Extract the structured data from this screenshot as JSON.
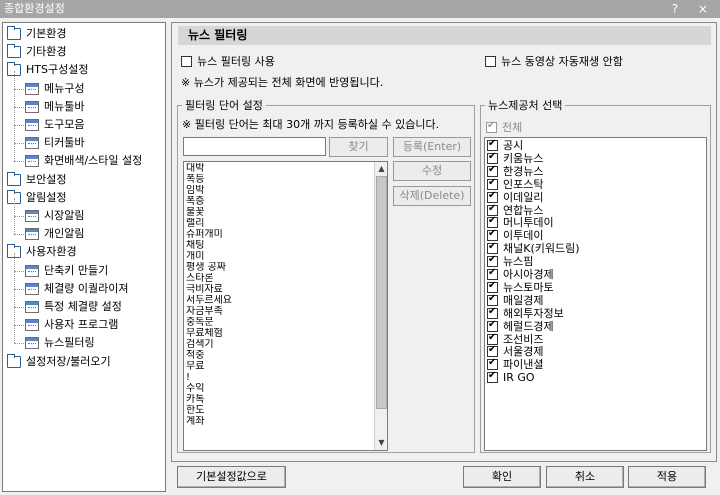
{
  "window": {
    "title": "종합환경설정",
    "controls": "? ×"
  },
  "tree": {
    "items": [
      {
        "label": "기본환경",
        "type": "folder",
        "level": 0
      },
      {
        "label": "기타환경",
        "type": "folder",
        "level": 0
      },
      {
        "label": "HTS구성설정",
        "type": "folder",
        "level": 0
      },
      {
        "label": "메뉴구성",
        "type": "page",
        "level": 1
      },
      {
        "label": "메뉴툴바",
        "type": "page",
        "level": 1
      },
      {
        "label": "도구모음",
        "type": "page",
        "level": 1
      },
      {
        "label": "티커툴바",
        "type": "page",
        "level": 1
      },
      {
        "label": "화면배색/스타일 설정",
        "type": "page",
        "level": 1
      },
      {
        "label": "보안설정",
        "type": "folder",
        "level": 0
      },
      {
        "label": "알림설정",
        "type": "folder",
        "level": 0
      },
      {
        "label": "시장알림",
        "type": "page",
        "level": 1
      },
      {
        "label": "개인알림",
        "type": "page",
        "level": 1
      },
      {
        "label": "사용자환경",
        "type": "folder",
        "level": 0
      },
      {
        "label": "단축키 만들기",
        "type": "page",
        "level": 1
      },
      {
        "label": "체결량 이퀄라이져",
        "type": "page",
        "level": 1
      },
      {
        "label": "특정 체결량 설정",
        "type": "page",
        "level": 1
      },
      {
        "label": "사용자 프로그램",
        "type": "page",
        "level": 1
      },
      {
        "label": "뉴스필터링",
        "type": "page",
        "level": 1
      },
      {
        "label": "설정저장/불러오기",
        "type": "folder",
        "level": 0
      }
    ]
  },
  "section": {
    "title": "뉴스 필터링"
  },
  "options": {
    "use_filter_label": "뉴스 필터링 사용",
    "use_filter_checked": false,
    "autoplay_label": "뉴스 동영상 자동재생 안함",
    "autoplay_checked": false,
    "note": "※ 뉴스가 제공되는 전체 화면에 반영됩니다."
  },
  "filter_words": {
    "group_title": "필터링 단어 설정",
    "hint": "※ 필터링 단어는 최대 30개 까지 등록하실 수 있습니다.",
    "input_value": "",
    "search_button": "찾기",
    "register_button": "등록(Enter)",
    "edit_button": "수정",
    "delete_button": "삭제(Delete)",
    "words": [
      "대박",
      "폭등",
      "임박",
      "폭증",
      "불꽃",
      "랠리",
      "슈퍼개미",
      "채팅",
      "개미",
      "평생 공짜",
      "스타론",
      "극비자료",
      "서두르세요",
      "자금부족",
      "중독문",
      "무료체험",
      "검색기",
      "적중",
      "무료",
      "!",
      "수익",
      "카톡",
      "한도",
      "계좌"
    ]
  },
  "providers": {
    "group_title": "뉴스제공처 선택",
    "all_label": "전체",
    "all_checked": true,
    "items": [
      {
        "label": "공시",
        "checked": true
      },
      {
        "label": "키움뉴스",
        "checked": true
      },
      {
        "label": "한경뉴스",
        "checked": true
      },
      {
        "label": "인포스탁",
        "checked": true
      },
      {
        "label": "이데일리",
        "checked": true
      },
      {
        "label": "연합뉴스",
        "checked": true
      },
      {
        "label": "머니투데이",
        "checked": true
      },
      {
        "label": "이투데이",
        "checked": true
      },
      {
        "label": "채널K(키워드림)",
        "checked": true
      },
      {
        "label": "뉴스핌",
        "checked": true
      },
      {
        "label": "아시아경제",
        "checked": true
      },
      {
        "label": "뉴스토마토",
        "checked": true
      },
      {
        "label": "매일경제",
        "checked": true
      },
      {
        "label": "해외투자정보",
        "checked": true
      },
      {
        "label": "헤럴드경제",
        "checked": true
      },
      {
        "label": "조선비즈",
        "checked": true
      },
      {
        "label": "서울경제",
        "checked": true
      },
      {
        "label": "파이낸셜",
        "checked": true
      },
      {
        "label": "IR GO",
        "checked": true
      }
    ]
  },
  "footer": {
    "defaults_button": "기본설정값으로",
    "ok_button": "확인",
    "cancel_button": "취소",
    "apply_button": "적용"
  },
  "colors": {
    "titlebar": "#a6a6a6",
    "folder_icon": "#2f5f93",
    "section_bg": "#d6d6d6"
  }
}
